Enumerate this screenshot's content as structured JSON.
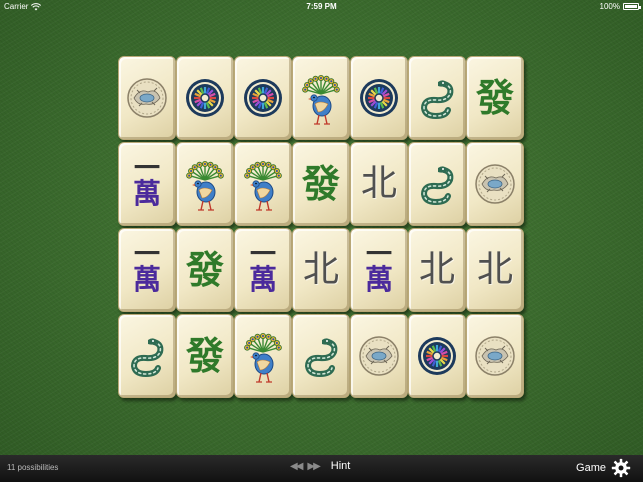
{
  "status_bar": {
    "carrier": "Carrier",
    "time": "7:59 PM",
    "battery": "100%"
  },
  "board": {
    "rows": [
      [
        "season",
        "circle-wheel",
        "circle-wheel",
        "peacock",
        "circle-wheel",
        "snake",
        "fa"
      ],
      [
        "wan",
        "peacock",
        "peacock",
        "fa",
        "bei",
        "snake",
        "season"
      ],
      [
        "wan",
        "fa",
        "wan",
        "bei",
        "wan",
        "bei",
        "bei"
      ],
      [
        "snake",
        "fa",
        "peacock",
        "snake",
        "season",
        "circle-wheel",
        "season"
      ]
    ],
    "glyphs": {
      "fa": "發",
      "bei": "北",
      "wan_top": "一",
      "wan_bottom": "萬"
    }
  },
  "bottom_bar": {
    "possibilities": "11 possibilities",
    "hint_label": "Hint",
    "game_label": "Game"
  },
  "colors": {
    "felt": "#3d6e2f",
    "tile": "#f1e8c6",
    "bar": "#1a1a1a",
    "fa_green": "#2f7a2a",
    "wan_purple": "#3a1e8a"
  }
}
